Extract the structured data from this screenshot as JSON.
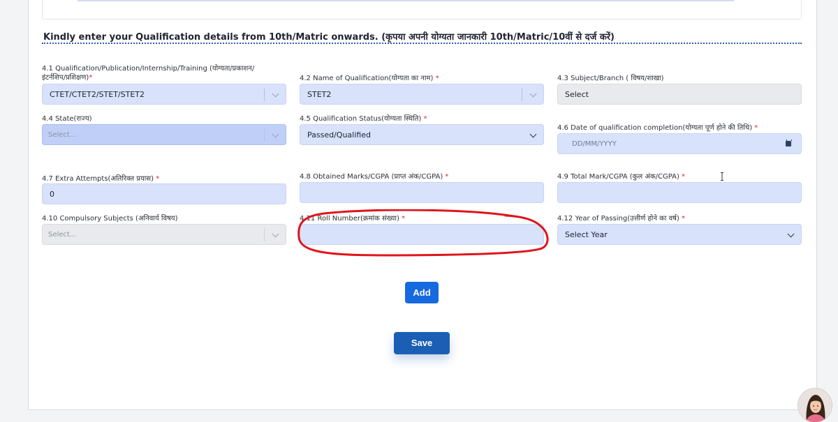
{
  "section": {
    "heading": "Kindly enter your Qualification details from 10th/Matric onwards. (कृपया अपनी योग्यता जानकारी 10th/Matric/10वीं से दर्ज करें)"
  },
  "fields": {
    "qualification_type": {
      "label": "4.1 Qualification/Publication/Internship/Training (योग्यता/प्रकाशन/इंटर्नशिप/प्रशिक्षण)",
      "required": "*",
      "value": "CTET/CTET2/STET/STET2"
    },
    "qualification_name": {
      "label": "4.2 Name of Qualification(योग्यता का नाम)",
      "required": "*",
      "value": "STET2"
    },
    "subject_branch": {
      "label": "4.3 Subject/Branch ( विषय/शाखा)",
      "value": "Select"
    },
    "state": {
      "label": "4.4 State(राज्य)",
      "placeholder": "Select..."
    },
    "qualification_status": {
      "label": "4.5 Qualification Status(योग्यता स्थिति)",
      "required": "*",
      "value": "Passed/Qualified"
    },
    "completion_date": {
      "label": "4.6 Date of qualification completion(योग्यता पूर्ण होने की तिथि)",
      "required": "*",
      "placeholder": "DD/MM/YYYY"
    },
    "extra_attempts": {
      "label": "4.7  Extra Attempts(अतिरिक्त प्रयास)",
      "required": "*",
      "value": "0"
    },
    "obtained_marks": {
      "label": "4.8 Obtained Marks/CGPA (प्राप्त अंक/CGPA)",
      "required": "*",
      "value": ""
    },
    "total_marks": {
      "label": "4.9 Total Mark/CGPA (कुल अंक/CGPA)",
      "required": "*",
      "value": ""
    },
    "compulsory_subjects": {
      "label": "4.10 Compulsory Subjects  (अनिवार्य विषय)",
      "placeholder": "Select..."
    },
    "roll_number": {
      "label": "4.11 Roll Number(क्रमांक संख्या)",
      "required": "*",
      "value": ""
    },
    "year_of_passing": {
      "label": "4.12 Year of Passing(उत्तीर्ण होने का वर्ष)",
      "required": "*",
      "value": "Select Year"
    }
  },
  "buttons": {
    "add": "Add",
    "save": "Save"
  },
  "colors": {
    "field_bg": "#d8e2fb",
    "primary_button": "#1769e0",
    "save_button": "#1a5fb4",
    "annotation_red": "#e0141b",
    "required_star": "#e0262d"
  },
  "icons": {
    "dropdown": "chevron-down-icon",
    "calendar": "calendar-icon",
    "text_cursor": "text-cursor-icon",
    "avatar": "avatar-icon"
  }
}
